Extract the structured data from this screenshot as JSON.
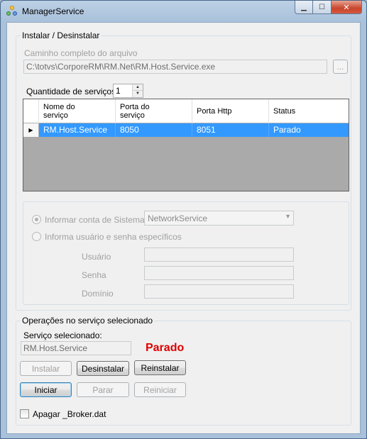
{
  "window": {
    "title": "ManagerService",
    "minimize_glyph": "▁",
    "maximize_glyph": "☐",
    "close_glyph": "✕"
  },
  "install_group": {
    "title": "Instalar / Desinstalar",
    "path_label": "Caminho completo do arquivo",
    "path_value": "C:\\totvs\\CorporeRM\\RM.Net\\RM.Host.Service.exe",
    "browse_label": "...",
    "quantity_label": "Quantidade de serviços",
    "quantity_value": "1",
    "grid": {
      "columns": [
        "Nome do\nserviço",
        "Porta do\nserviço",
        "Porta Http",
        "Status"
      ],
      "rows": [
        {
          "selector": "▶",
          "nome": "RM.Host.Service",
          "porta": "8050",
          "http": "8051",
          "status": "Parado"
        }
      ]
    },
    "account": {
      "system_radio_label": "Informar conta de Sistema",
      "system_account_value": "NetworkService",
      "user_radio_label": "Informa usuário e senha específicos",
      "usuario_label": "Usuário",
      "senha_label": "Senha",
      "dominio_label": "Domínio"
    }
  },
  "ops_group": {
    "title": "Operações no serviço selecionado",
    "selected_label": "Serviço selecionado:",
    "selected_value": "RM.Host.Service",
    "status_text": "Parado",
    "status_color": "#e00000",
    "buttons": {
      "instalar": "Instalar",
      "desinstalar": "Desinstalar",
      "reinstalar": "Reinstalar",
      "iniciar": "Iniciar",
      "parar": "Parar",
      "reiniciar": "Reiniciar"
    },
    "delete_broker_label": "Apagar _Broker.dat",
    "delete_broker_checked": false
  }
}
